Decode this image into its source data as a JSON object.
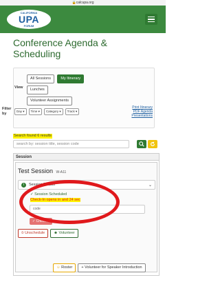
{
  "browser": {
    "url": "calcupa.org"
  },
  "header": {
    "logo_top": "CALIFORNIA",
    "logo_main": "UPA",
    "logo_bottom": "FORUM",
    "menu_icon": "hamburger-icon"
  },
  "page": {
    "title": "Conference Agenda & Scheduling"
  },
  "views": {
    "all_sessions": "All Sessions",
    "my_itinerary": "My Itinerary",
    "view_label": "View",
    "lunches": "Lunches",
    "volunteer_assignments": "Volunteer Assignments",
    "filter_label": "Filter by",
    "filters": [
      "Day",
      "Time",
      "Category",
      "Track"
    ],
    "links": [
      "Print Itinerary",
      "PDF Agenda",
      "Presentations"
    ]
  },
  "search": {
    "found": "Search found 6 results",
    "placeholder": "search by: session title, session code"
  },
  "session": {
    "header": "Session",
    "title": "Test Session",
    "code": "W-A11",
    "day": "Wednesday",
    "time": "10:30am to 11am",
    "details_label": "Session Details",
    "scheduled": "Session Scheduled",
    "checkin_msg": "Check-In opens in and 24 sec",
    "code_placeholder": "code",
    "checkin_button": "Check In",
    "unschedule": "Unschedule",
    "volunteer": "Volunteer",
    "roster": "Roster",
    "volunteer_intro": "Volunteer for Speaker Introduction"
  },
  "colors": {
    "brand": "#3c8a3f",
    "link": "#1e5fa0",
    "annotation": "#e0191c",
    "highlight": "#fff200"
  }
}
